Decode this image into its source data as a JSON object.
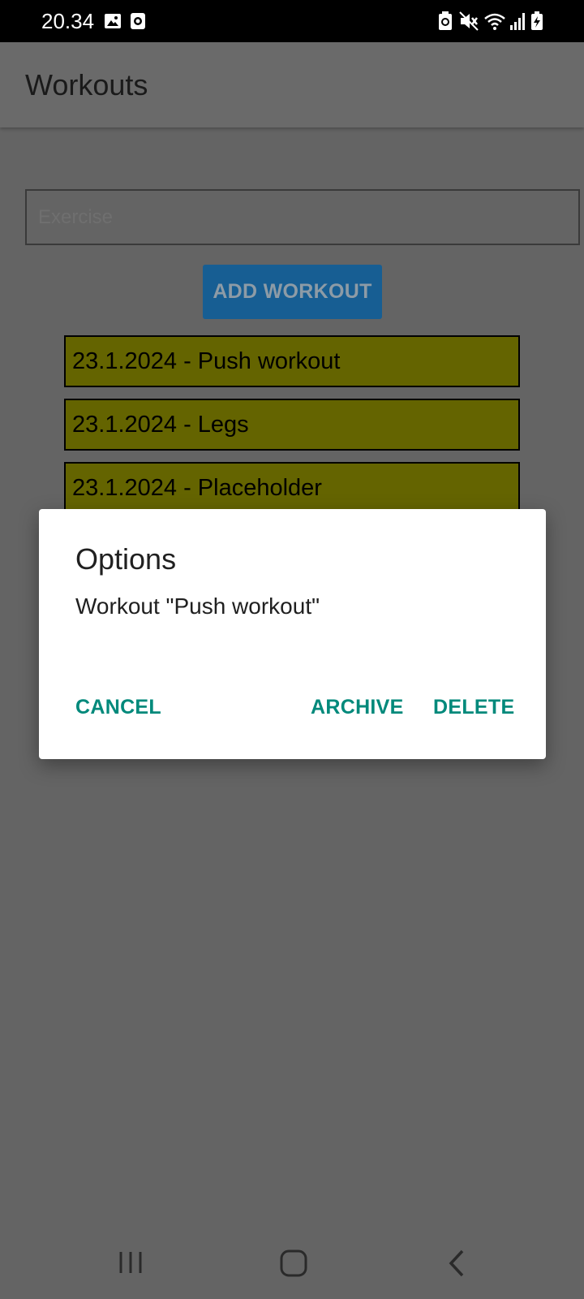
{
  "status_bar": {
    "time": "20.34",
    "left_icons": [
      "image-icon",
      "record-icon"
    ],
    "right_icons": [
      "battery-saver-icon",
      "mute-icon",
      "wifi-icon",
      "signal-icon",
      "battery-icon"
    ]
  },
  "app_bar": {
    "title": "Workouts"
  },
  "exercise_input": {
    "placeholder": "Exercise",
    "value": ""
  },
  "add_button": {
    "label": "ADD WORKOUT"
  },
  "workouts": [
    {
      "label": "23.1.2024 - Push workout"
    },
    {
      "label": "23.1.2024 - Legs"
    },
    {
      "label": "23.1.2024 - Placeholder"
    }
  ],
  "dialog": {
    "title": "Options",
    "message": "Workout \"Push workout\"",
    "cancel_label": "CANCEL",
    "archive_label": "ARCHIVE",
    "delete_label": "DELETE"
  },
  "nav_bar": {
    "icons": [
      "recent-apps-icon",
      "home-icon",
      "back-icon"
    ]
  },
  "colors": {
    "scrim": "#646464",
    "workout_item_bg": "#646400",
    "add_button_bg": "#175e93",
    "dialog_accent": "#00897b"
  }
}
